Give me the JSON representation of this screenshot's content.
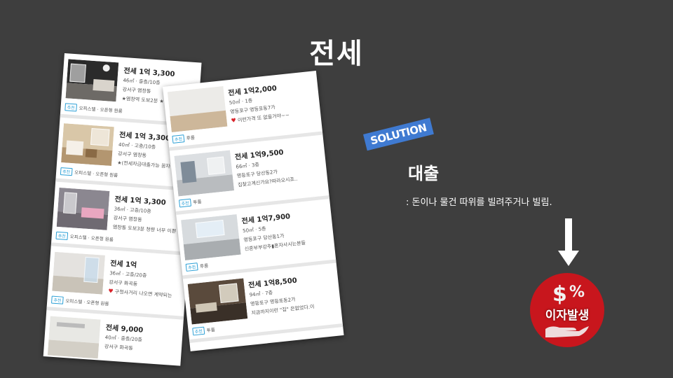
{
  "slide": {
    "title": "전세"
  },
  "left_listings": [
    {
      "price": "전세 1억 3,300",
      "area": "46㎡ · 중층/10층",
      "location": "강서구 염창동",
      "desc": "★염창역 도보2분 ★",
      "badge": "추천",
      "tags": "오피스텔 · 오픈형 원룸"
    },
    {
      "price": "전세 1억 3,300",
      "area": "40㎡ · 고층/10층",
      "location": "강서구 염창동",
      "desc": "★(전세자금대출가능 꿈자",
      "badge": "추천",
      "tags": "오피스텔 · 오픈형 원룸"
    },
    {
      "price": "전세 1억 3,300",
      "area": "36㎡ · 고층/10층",
      "location": "강서구 염창동",
      "desc": "염창동 도보3분 청량 너무 이쁜",
      "badge": "추천",
      "tags": "오피스텔 · 오픈형 원룸"
    },
    {
      "price": "전세 1억",
      "area": "36㎡ · 고층/20층",
      "location": "강서구 화곡동",
      "desc": "구청사거리 나오면 계약되는",
      "badge": "추천",
      "tags": "오피스텔 · 오픈형 원룸"
    },
    {
      "price": "전세 9,000",
      "area": "40㎡ · 중층/20층",
      "location": "강서구 화곡동",
      "desc": "",
      "badge": "",
      "tags": ""
    }
  ],
  "right_listings": [
    {
      "price": "전세 1억2,000",
      "area": "50㎡ · 1층",
      "location": "영등포구 영등포동7가",
      "desc": "이런가격 또 없을거야~~",
      "badge": "추천",
      "tags": "투룸"
    },
    {
      "price": "전세 1억9,500",
      "area": "66㎡ · 3층",
      "location": "영등포구 당산동2가",
      "desc": "집찾고계신가요?따라오시죠..",
      "badge": "추천",
      "tags": "투룸"
    },
    {
      "price": "전세 1억7,900",
      "area": "50㎡ · 5층",
      "location": "영등포구 당산동1가",
      "desc": "신혼부부강추▮혼자사시는분들",
      "badge": "추천",
      "tags": "투룸"
    },
    {
      "price": "전세 1억8,500",
      "area": "94㎡ · 7층",
      "location": "영등포구 영등포동2가",
      "desc": "지금까지이런 \"집\" 은없었다.이",
      "badge": "추천",
      "tags": "투룸"
    }
  ],
  "solution": {
    "tag": "SOLUTION",
    "title": "대출",
    "description": ": 돈이나 물건 따위를 빌려주거나 빌림."
  },
  "interest": {
    "label": "이자발생",
    "icon": "money-percent-icon"
  },
  "colors": {
    "background": "#3e3e3e",
    "solution_tag": "#3f7ad1",
    "interest_badge": "#c8161d",
    "listing_badge": "#2a9fd6"
  }
}
